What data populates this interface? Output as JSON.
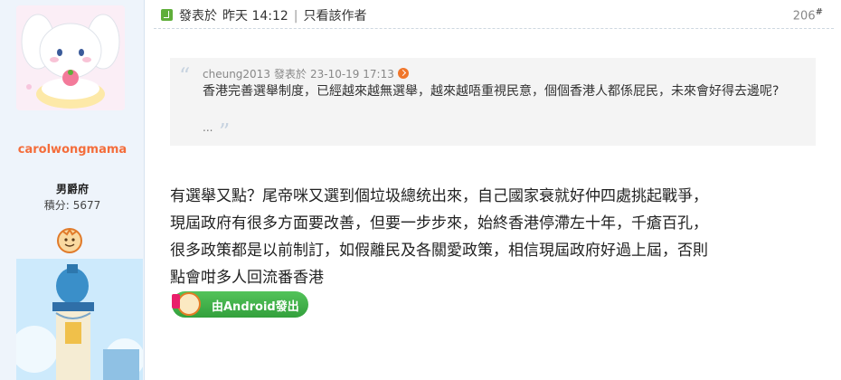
{
  "user": {
    "username": "carolwongmama",
    "rank": "男爵府",
    "points_label": "積分:",
    "points": "5677"
  },
  "post": {
    "posted_label": "發表於",
    "time": "昨天 14:12",
    "author_only": "只看該作者",
    "floor": "206",
    "floor_suffix": "#",
    "quote": {
      "author": "cheung2013",
      "posted_label": "發表於",
      "date": "23-10-19 17:13",
      "text": "香港完善選舉制度，已經越來越無選舉，越來越唔重視民意，個個香港人都係屁民，未來會好得去邊呢?",
      "more": "..."
    },
    "body_lines": [
      "有選舉又點？尾帝咪又選到個垃圾總统出來，自己國家衰就好仲四處挑起戰爭，",
      "現屆政府有很多方面要改善，但要一步步來，始終香港停滯左十年，千瘡百孔，",
      "很多政策都是以前制訂，如假離民及各關愛政策，相信現屆政府好過上屆，否則",
      "點會咁多人回流番香港"
    ],
    "app_badge": "由Android發出"
  },
  "colors": {
    "username": "#f46d3b",
    "badge_green": "#3fae45",
    "quote_bg": "#f4f4f4"
  }
}
